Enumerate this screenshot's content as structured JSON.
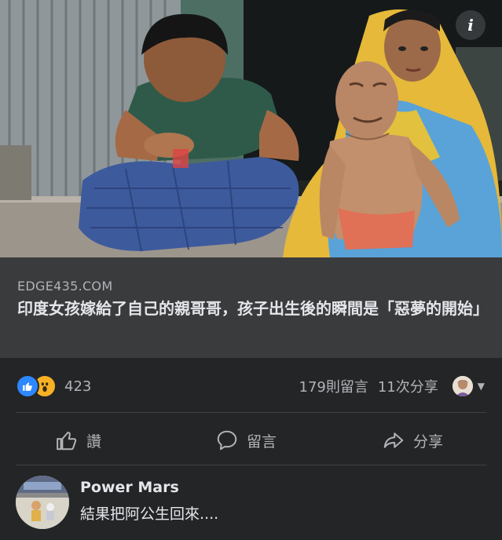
{
  "link_preview": {
    "domain": "EDGE435.COM",
    "title": "印度女孩嫁給了自己的親哥哥，孩子出生後的瞬間是「惡夢的開始」"
  },
  "reactions": {
    "icons": [
      "like-icon",
      "wow-icon"
    ],
    "count": "423"
  },
  "stats": {
    "comments": "179則留言",
    "shares": "11次分享"
  },
  "actions": {
    "like": "讚",
    "comment": "留言",
    "share": "分享"
  },
  "comment": {
    "author": "Power Mars",
    "text": "結果把阿公生回來...."
  },
  "colors": {
    "background": "#242526",
    "link_box": "#3a3b3c",
    "text_primary": "#e4e6eb",
    "text_secondary": "#b0b3b8",
    "like_blue": "#2d88ff",
    "wow_yellow": "#f7b125"
  }
}
